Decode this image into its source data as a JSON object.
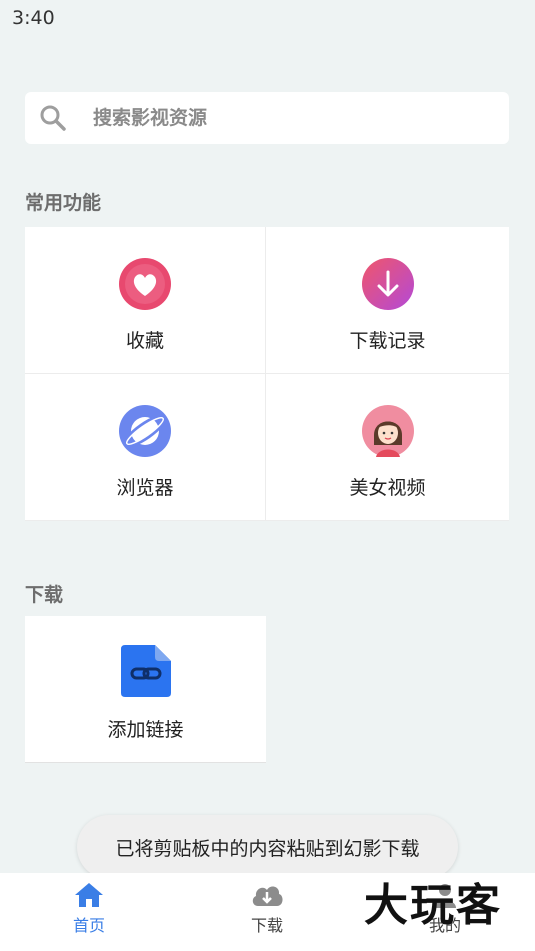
{
  "status_bar": {
    "time": "3:40"
  },
  "search": {
    "placeholder": "搜索影视资源",
    "icon": "search-icon"
  },
  "common_section": {
    "title": "常用功能",
    "items": [
      {
        "label": "收藏",
        "icon": "heart-icon",
        "color": "#e8496f"
      },
      {
        "label": "下载记录",
        "icon": "download-arrow-icon",
        "color": "#d94fb0"
      },
      {
        "label": "浏览器",
        "icon": "planet-browser-icon",
        "color": "#6b86ee"
      },
      {
        "label": "美女视频",
        "icon": "girl-avatar-icon",
        "color": "#f08da0"
      }
    ]
  },
  "download_section": {
    "title": "下载",
    "items": [
      {
        "label": "添加链接",
        "icon": "link-file-icon",
        "color": "#2b74f0"
      }
    ]
  },
  "toast": {
    "message": "已将剪贴板中的内容粘贴到幻影下载"
  },
  "bottom_nav": {
    "items": [
      {
        "label": "首页",
        "icon": "home-icon",
        "active": true
      },
      {
        "label": "下载",
        "icon": "cloud-download-icon",
        "active": false
      },
      {
        "label": "我的",
        "icon": "user-icon",
        "active": false
      }
    ],
    "accent": "#3a7ee6"
  },
  "watermark": {
    "text": "大玩客"
  }
}
